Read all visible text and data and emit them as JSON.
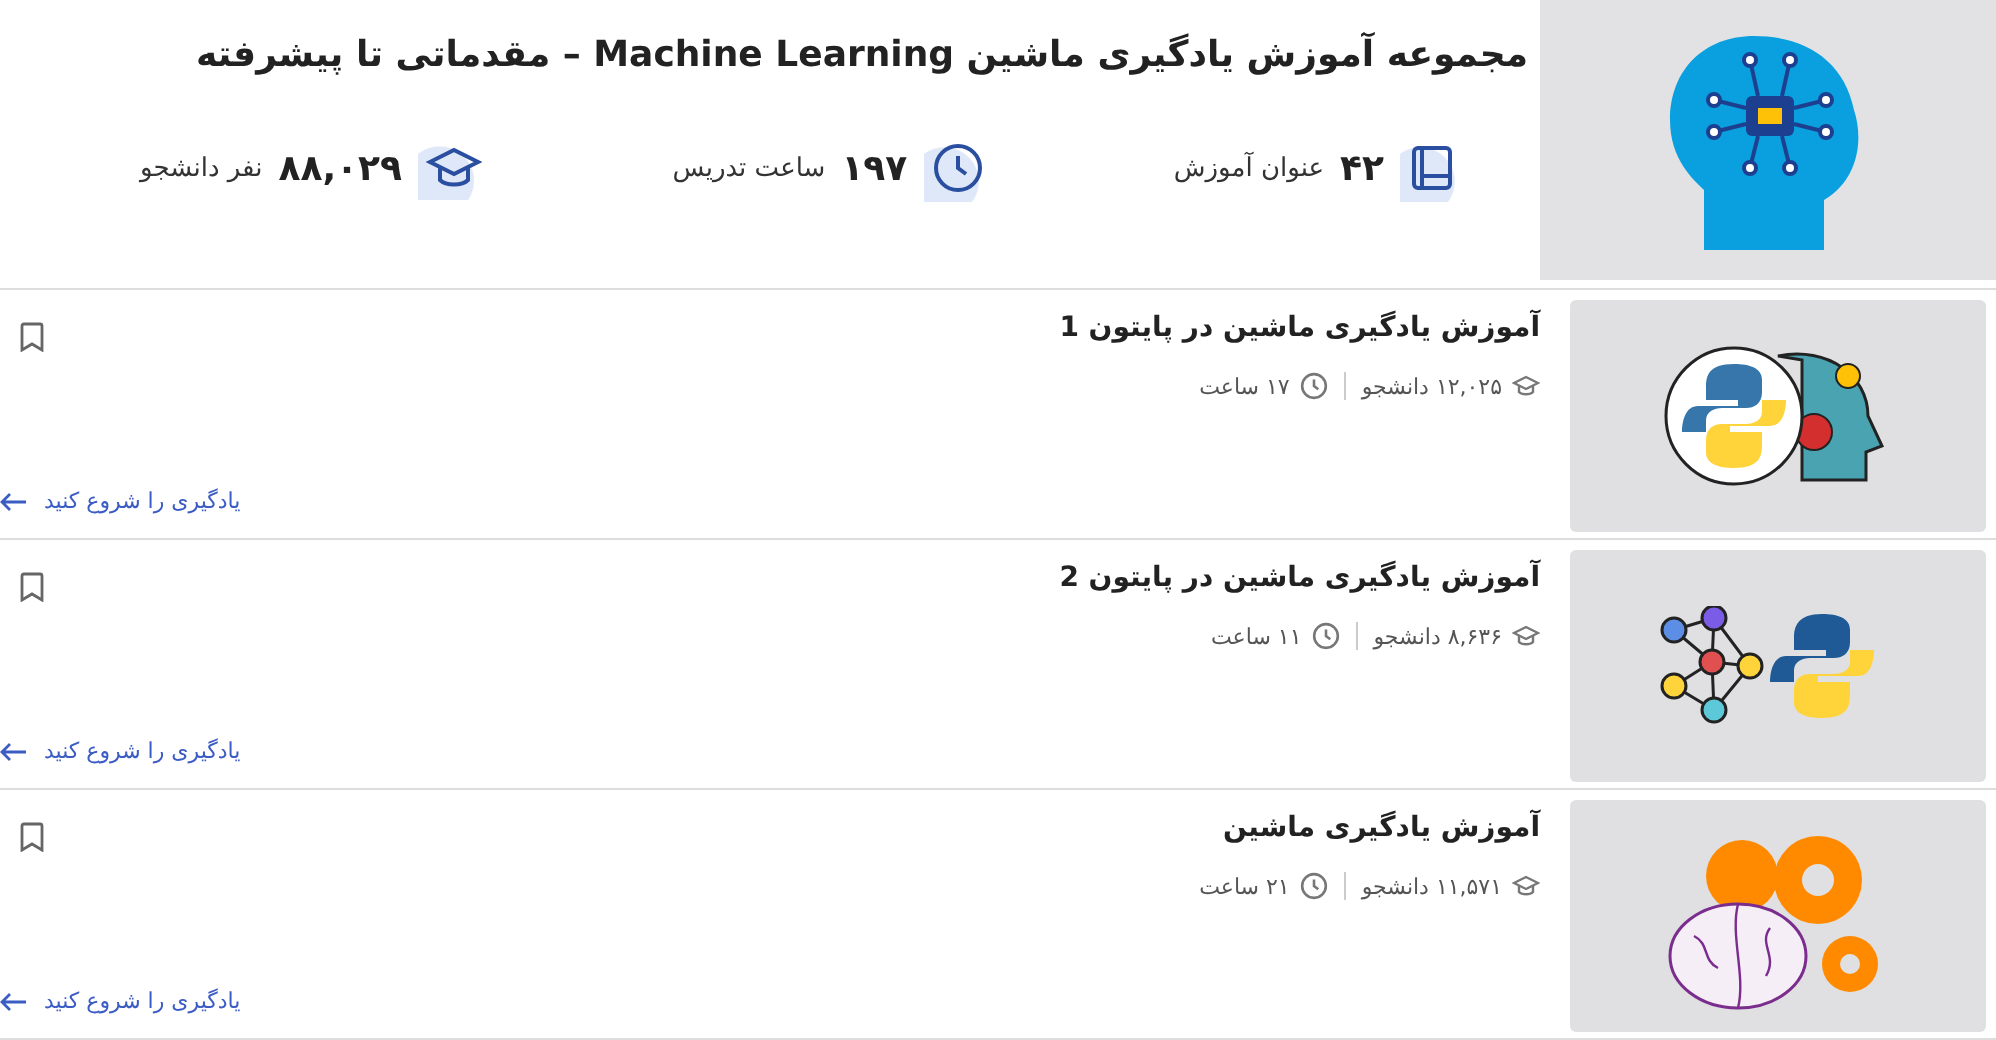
{
  "header": {
    "title": "مجموعه آموزش یادگیری ماشین Machine Learning – مقدماتی تا پیشرفته",
    "stats": [
      {
        "value": "۴۲",
        "label": "عنوان آموزش"
      },
      {
        "value": "۱۹۷",
        "label": "ساعت تدریس"
      },
      {
        "value": "۸۸,۰۲۹",
        "label": "نفر دانشجو"
      }
    ]
  },
  "courses": [
    {
      "title": "آموزش یادگیری ماشین در پایتون 1",
      "students": "۱۲,۰۲۵ دانشجو",
      "hours": "۱۷ ساعت",
      "link": "یادگیری را شروع کنید"
    },
    {
      "title": "آموزش یادگیری ماشین در پایتون 2",
      "students": "۸,۶۳۶ دانشجو",
      "hours": "۱۱ ساعت",
      "link": "یادگیری را شروع کنید"
    },
    {
      "title": "آموزش یادگیری ماشین",
      "students": "۱۱,۵۷۱ دانشجو",
      "hours": "۲۱ ساعت",
      "link": "یادگیری را شروع کنید"
    }
  ]
}
